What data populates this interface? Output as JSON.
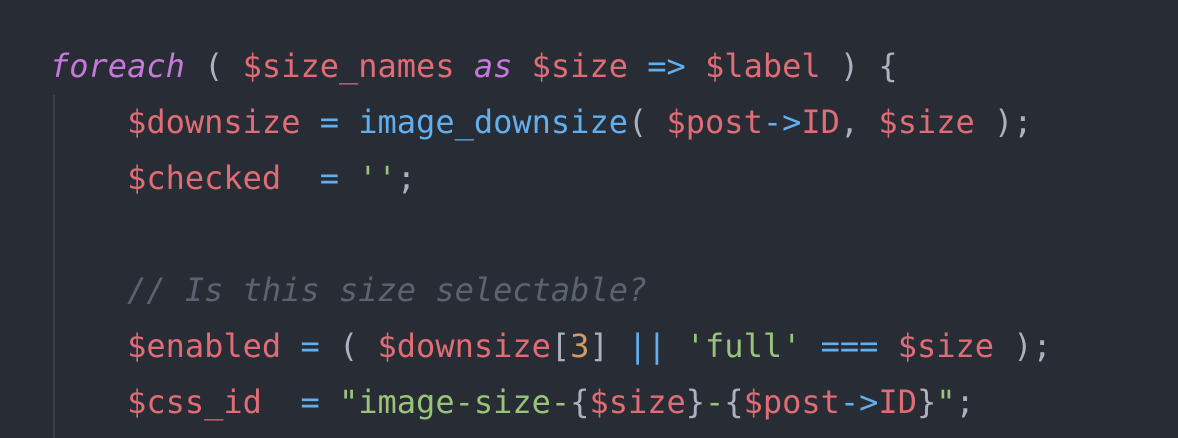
{
  "editor": {
    "language": "php",
    "theme_colors": {
      "background": "#282c34",
      "keyword": "#c678dd",
      "variable": "#e06c75",
      "function": "#61afef",
      "string": "#98c379",
      "number": "#d19a66",
      "comment": "#5c6370"
    },
    "lines": [
      [
        [
          "foreach",
          "kw"
        ],
        [
          " ( ",
          "pn"
        ],
        [
          "$size_names",
          "var"
        ],
        [
          " ",
          "pn"
        ],
        [
          "as",
          "kw"
        ],
        [
          " ",
          "pn"
        ],
        [
          "$size",
          "var"
        ],
        [
          " ",
          "pn"
        ],
        [
          "=>",
          "op"
        ],
        [
          " ",
          "pn"
        ],
        [
          "$label",
          "var"
        ],
        [
          " ) {",
          "pn"
        ]
      ],
      [
        [
          "    ",
          "pn"
        ],
        [
          "$downsize",
          "var"
        ],
        [
          " ",
          "pn"
        ],
        [
          "=",
          "op"
        ],
        [
          " ",
          "pn"
        ],
        [
          "image_downsize",
          "fn"
        ],
        [
          "( ",
          "pn"
        ],
        [
          "$post",
          "var"
        ],
        [
          "->",
          "op"
        ],
        [
          "ID",
          "var"
        ],
        [
          ", ",
          "pn"
        ],
        [
          "$size",
          "var"
        ],
        [
          " );",
          "pn"
        ]
      ],
      [
        [
          "    ",
          "pn"
        ],
        [
          "$checked",
          "var"
        ],
        [
          "  ",
          "pn"
        ],
        [
          "=",
          "op"
        ],
        [
          " ",
          "pn"
        ],
        [
          "''",
          "str"
        ],
        [
          ";",
          "pn"
        ]
      ],
      [],
      [
        [
          "    ",
          "pn"
        ],
        [
          "// Is this size selectable?",
          "cm"
        ]
      ],
      [
        [
          "    ",
          "pn"
        ],
        [
          "$enabled",
          "var"
        ],
        [
          " ",
          "pn"
        ],
        [
          "=",
          "op"
        ],
        [
          " ( ",
          "pn"
        ],
        [
          "$downsize",
          "var"
        ],
        [
          "[",
          "pn"
        ],
        [
          "3",
          "num"
        ],
        [
          "] ",
          "pn"
        ],
        [
          "||",
          "op"
        ],
        [
          " ",
          "pn"
        ],
        [
          "'full'",
          "str"
        ],
        [
          " ",
          "pn"
        ],
        [
          "===",
          "op"
        ],
        [
          " ",
          "pn"
        ],
        [
          "$size",
          "var"
        ],
        [
          " );",
          "pn"
        ]
      ],
      [
        [
          "    ",
          "pn"
        ],
        [
          "$css_id",
          "var"
        ],
        [
          "  ",
          "pn"
        ],
        [
          "=",
          "op"
        ],
        [
          " ",
          "pn"
        ],
        [
          "\"image-size-",
          "str"
        ],
        [
          "{",
          "pn"
        ],
        [
          "$size",
          "var"
        ],
        [
          "}",
          "pn"
        ],
        [
          "-",
          "str"
        ],
        [
          "{",
          "pn"
        ],
        [
          "$post",
          "var"
        ],
        [
          "->",
          "op"
        ],
        [
          "ID",
          "var"
        ],
        [
          "}",
          "pn"
        ],
        [
          "\"",
          "str"
        ],
        [
          ";",
          "pn"
        ]
      ]
    ]
  }
}
